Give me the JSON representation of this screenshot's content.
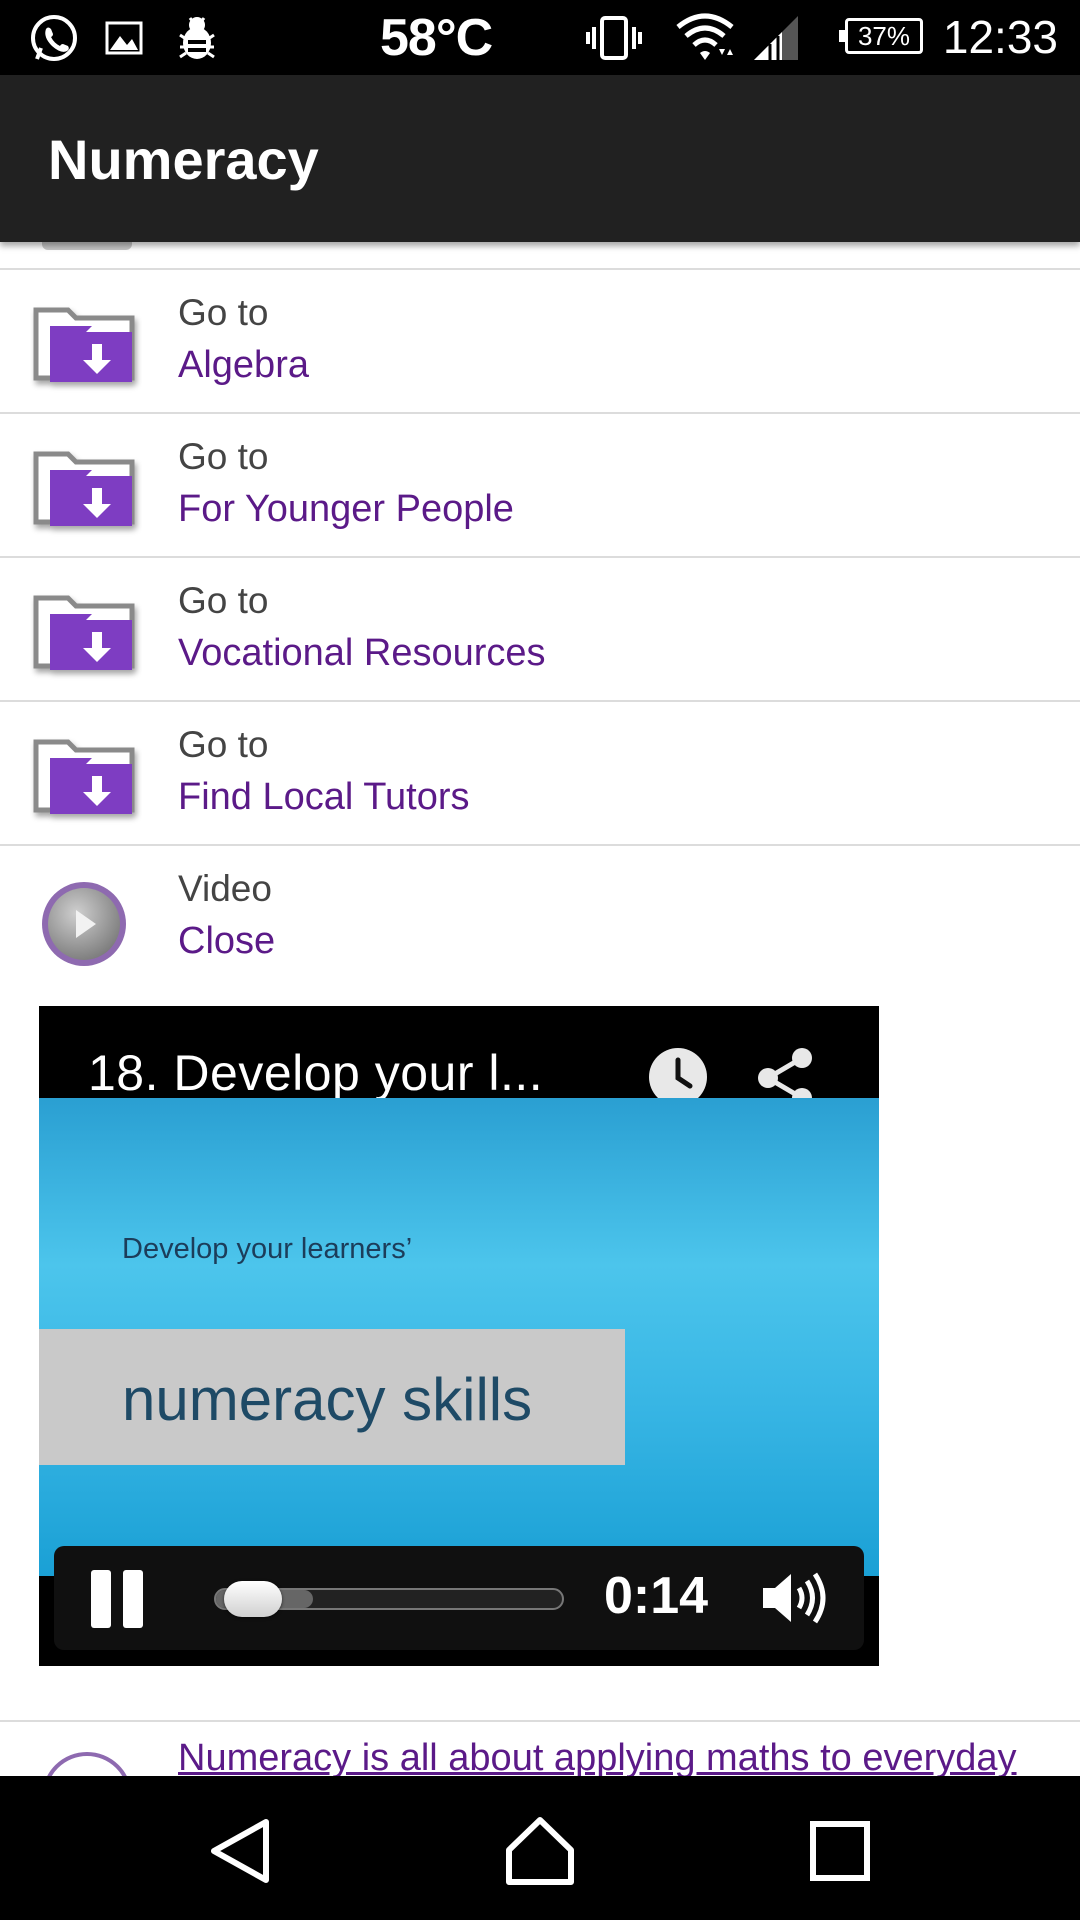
{
  "status_bar": {
    "temperature": "58°C",
    "battery": "37%",
    "time": "12:33",
    "icons": [
      "whatsapp-icon",
      "gallery-icon",
      "debug-bug-icon",
      "vibrate-icon",
      "wifi-icon",
      "signal-icon",
      "battery-icon"
    ]
  },
  "app_bar": {
    "title": "Numeracy"
  },
  "list": {
    "items": [
      {
        "prefix": "Go to",
        "link": "Algebra",
        "icon": "folder-download-icon"
      },
      {
        "prefix": "Go to",
        "link": "For Younger People",
        "icon": "folder-download-icon"
      },
      {
        "prefix": "Go to",
        "link": "Vocational Resources",
        "icon": "folder-download-icon"
      },
      {
        "prefix": "Go to",
        "link": "Find Local Tutors",
        "icon": "folder-download-icon"
      }
    ],
    "video_item": {
      "prefix": "Video",
      "link": "Close",
      "icon": "play-circle-icon"
    },
    "next_item_text": "Numeracy is all about applying maths to everyday"
  },
  "video_player": {
    "title": "18. Develop your l...",
    "frame_caption": "Develop your learners’",
    "frame_heading": "numeracy skills",
    "current_time": "0:14",
    "progress_fraction": 0.28,
    "icons": [
      "watch-later-clock-icon",
      "share-icon",
      "pause-icon",
      "volume-icon"
    ]
  },
  "colors": {
    "accent": "#5b1a88",
    "app_bar": "#212121",
    "folder_purple": "#7e3ec2"
  },
  "nav_bar": {
    "icons": [
      "back-icon",
      "home-icon",
      "recents-icon"
    ]
  }
}
